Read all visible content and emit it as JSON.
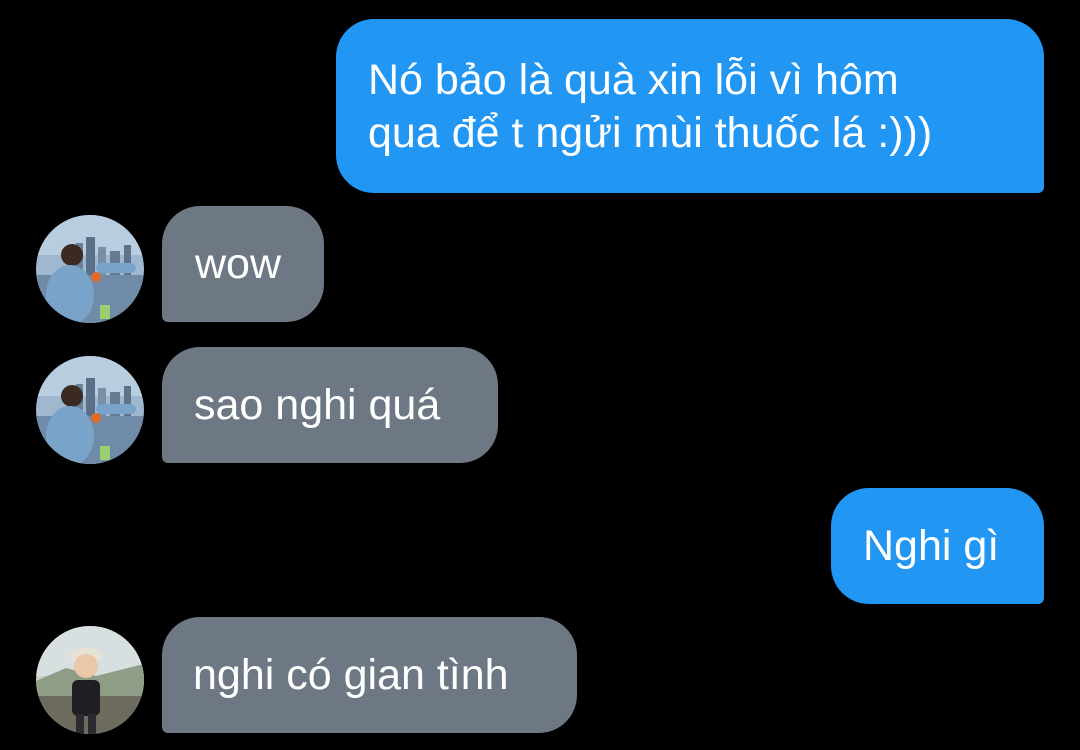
{
  "conversation": {
    "messages": [
      {
        "side": "sent",
        "text_line1": "Nó bảo là quà xin lỗi vì hôm",
        "text_line2": "qua để t ngửi mùi thuốc lá :)))"
      },
      {
        "side": "received",
        "avatar": "contact-photo-city",
        "text": "wow"
      },
      {
        "side": "received",
        "avatar": "contact-photo-city",
        "text": "sao nghi quá"
      },
      {
        "side": "sent",
        "text": "Nghi gì"
      },
      {
        "side": "received",
        "avatar": "contact-photo-child",
        "text": "nghi có gian tình"
      }
    ]
  },
  "colors": {
    "background": "#000000",
    "sent_bubble": "#2196f3",
    "received_bubble": "#6e7884",
    "text": "#ffffff"
  }
}
